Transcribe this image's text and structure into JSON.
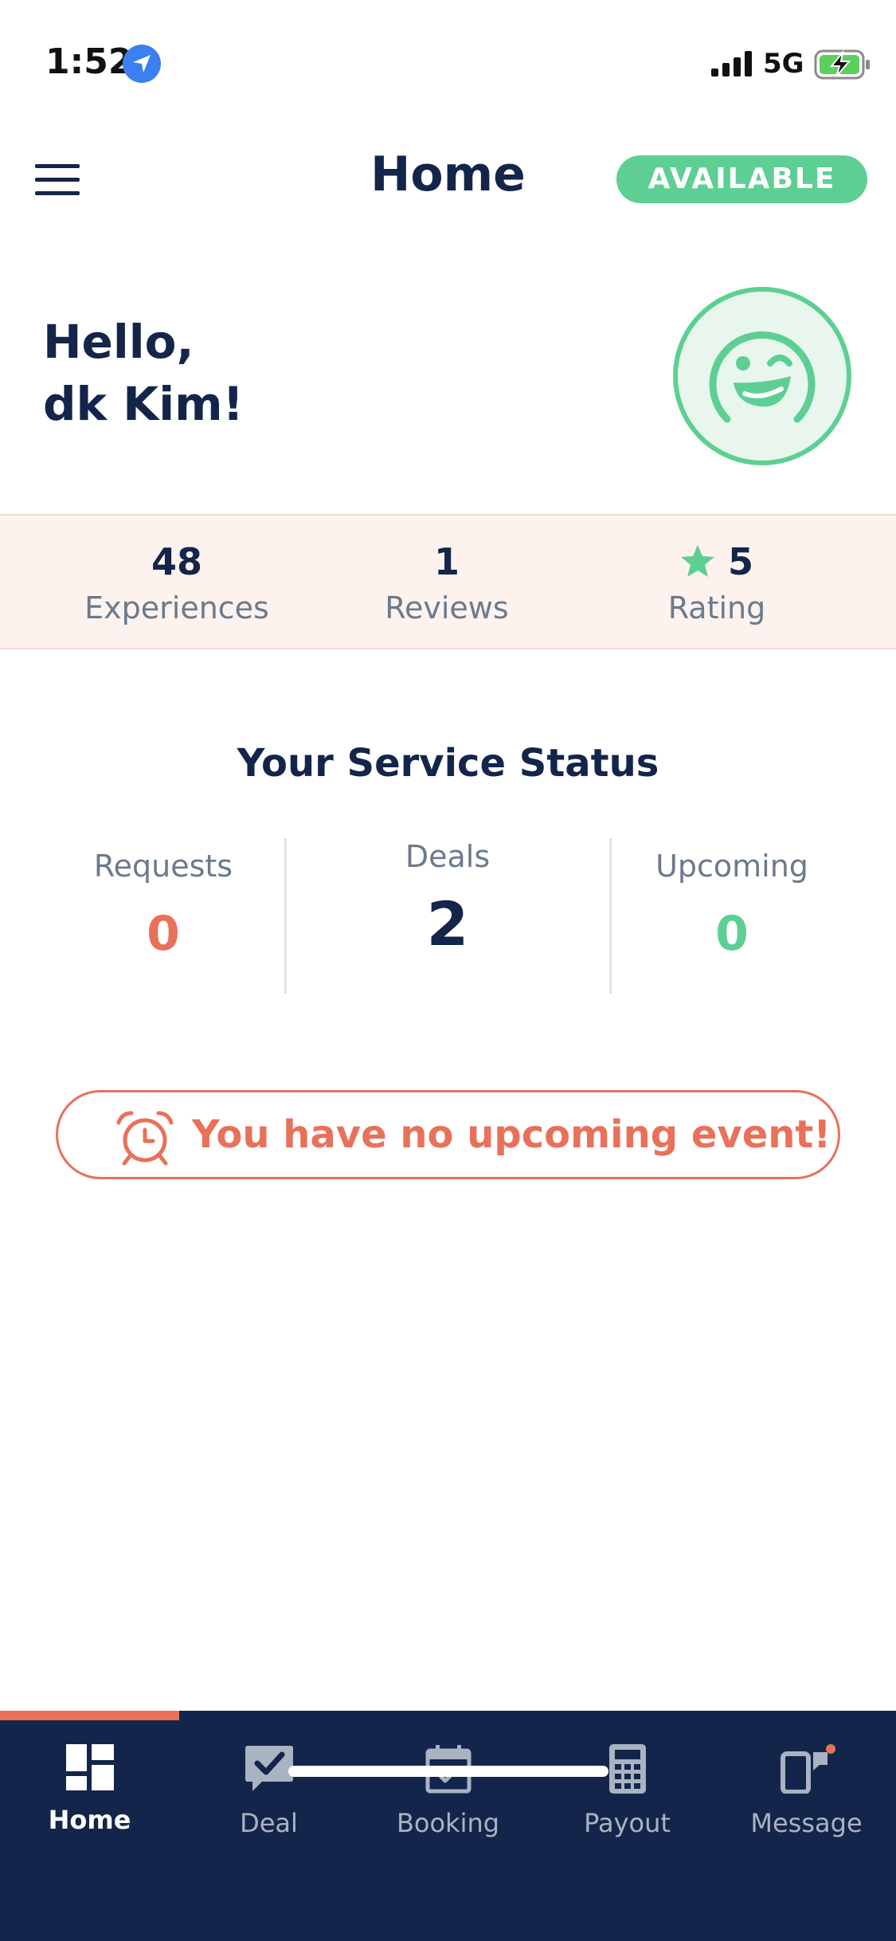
{
  "status_bar": {
    "time": "1:52",
    "network": "5G"
  },
  "header": {
    "title": "Home",
    "status_badge": "AVAILABLE"
  },
  "greeting": {
    "line1": "Hello,",
    "line2": "dk Kim!"
  },
  "stats": [
    {
      "value": "48",
      "label": "Experiences"
    },
    {
      "value": "1",
      "label": "Reviews"
    },
    {
      "value": "5",
      "label": "Rating"
    }
  ],
  "service_status": {
    "title": "Your Service Status",
    "items": [
      {
        "label": "Requests",
        "value": "0",
        "color": "#e9715a"
      },
      {
        "label": "Deals",
        "value": "2",
        "color": "#13254a"
      },
      {
        "label": "Upcoming",
        "value": "0",
        "color": "#5dcf93"
      }
    ]
  },
  "alert": {
    "text": "You have no upcoming event!",
    "icon": "alarm-clock-icon"
  },
  "nav": {
    "active": "Home",
    "items": [
      {
        "label": "Home",
        "icon": "dashboard-icon"
      },
      {
        "label": "Deal",
        "icon": "chat-check-icon"
      },
      {
        "label": "Booking",
        "icon": "calendar-check-icon"
      },
      {
        "label": "Payout",
        "icon": "calculator-icon"
      },
      {
        "label": "Message",
        "icon": "devices-icon"
      }
    ]
  },
  "colors": {
    "navy": "#13254a",
    "green": "#5dcf93",
    "coral": "#e9715a",
    "band": "#fdf2ee"
  }
}
